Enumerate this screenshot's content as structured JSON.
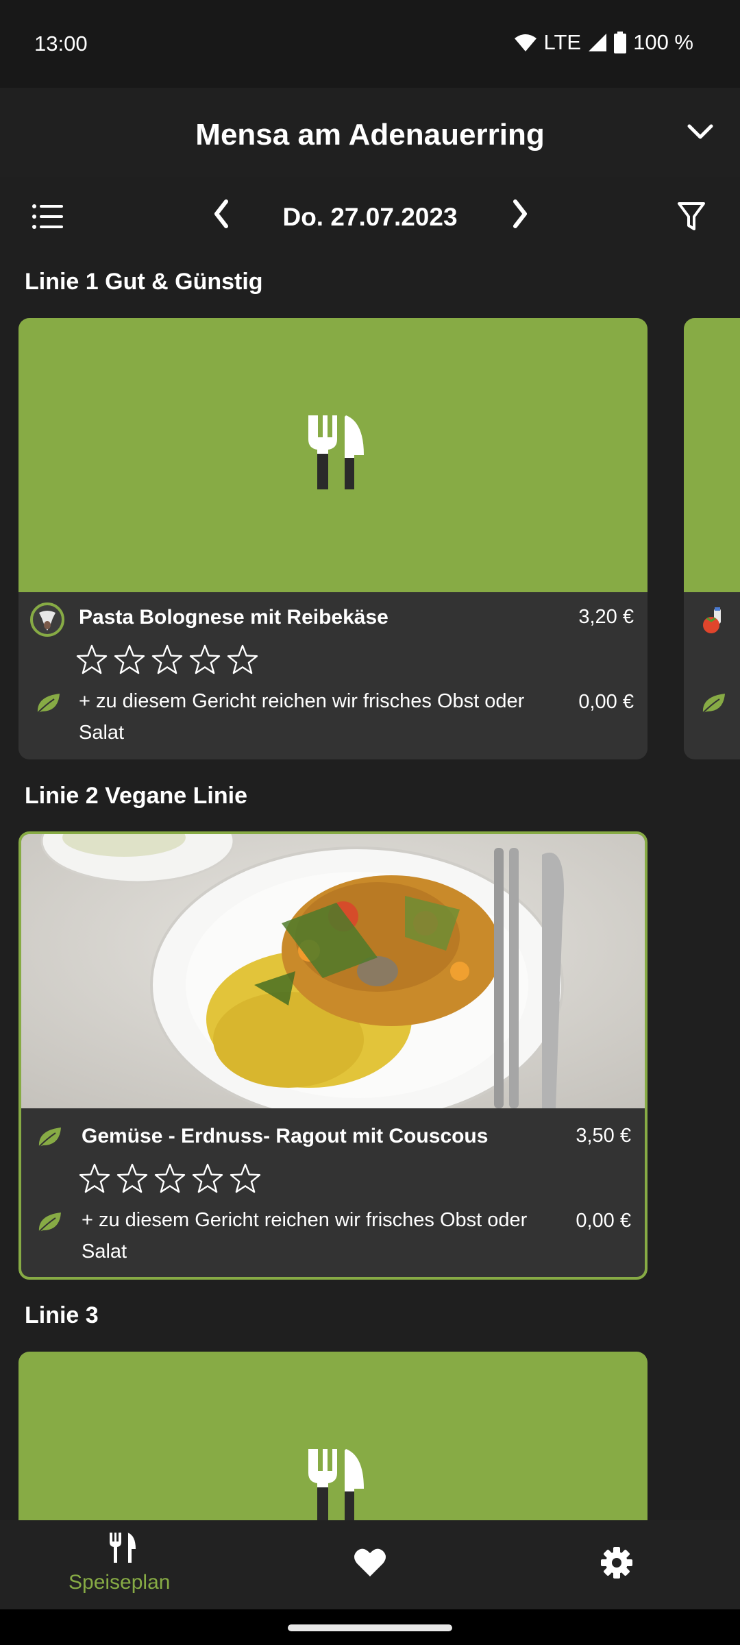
{
  "status_bar": {
    "time": "13:00",
    "network": "LTE",
    "battery": "100 %"
  },
  "header": {
    "title": "Mensa am Adenauerring"
  },
  "date_nav": {
    "date": "Do. 27.07.2023"
  },
  "sections": [
    {
      "title": "Linie 1 Gut & Günstig",
      "meal": {
        "name": "Pasta Bolognese mit Reibekäse",
        "price": "3,20 €",
        "icon": "beef-icon"
      },
      "side": {
        "text": "+ zu diesem Gericht reichen wir frisches Obst oder Salat",
        "price": "0,00 €",
        "icon": "vegan-leaf-icon"
      },
      "rating": {
        "stars_filled": 0,
        "stars_total": 5
      }
    },
    {
      "title": "Linie 2 Vegane Linie",
      "meal": {
        "name": "Gemüse - Erdnuss- Ragout mit Couscous",
        "price": "3,50 €",
        "icon": "vegan-leaf-icon"
      },
      "side": {
        "text": "+ zu diesem Gericht reichen wir frisches Obst oder Salat",
        "price": "0,00 €",
        "icon": "vegan-leaf-icon"
      },
      "rating": {
        "stars_filled": 0,
        "stars_total": 5
      }
    },
    {
      "title": "Linie 3"
    }
  ],
  "bottom_nav": {
    "items": [
      {
        "label": "Speiseplan",
        "icon": "cutlery-icon",
        "active": true
      },
      {
        "label": "",
        "icon": "heart-icon",
        "active": false
      },
      {
        "label": "",
        "icon": "settings-gear-icon",
        "active": false
      }
    ]
  },
  "colors": {
    "accent": "#87ab45",
    "background": "#1f1f1f",
    "card": "#333333"
  }
}
